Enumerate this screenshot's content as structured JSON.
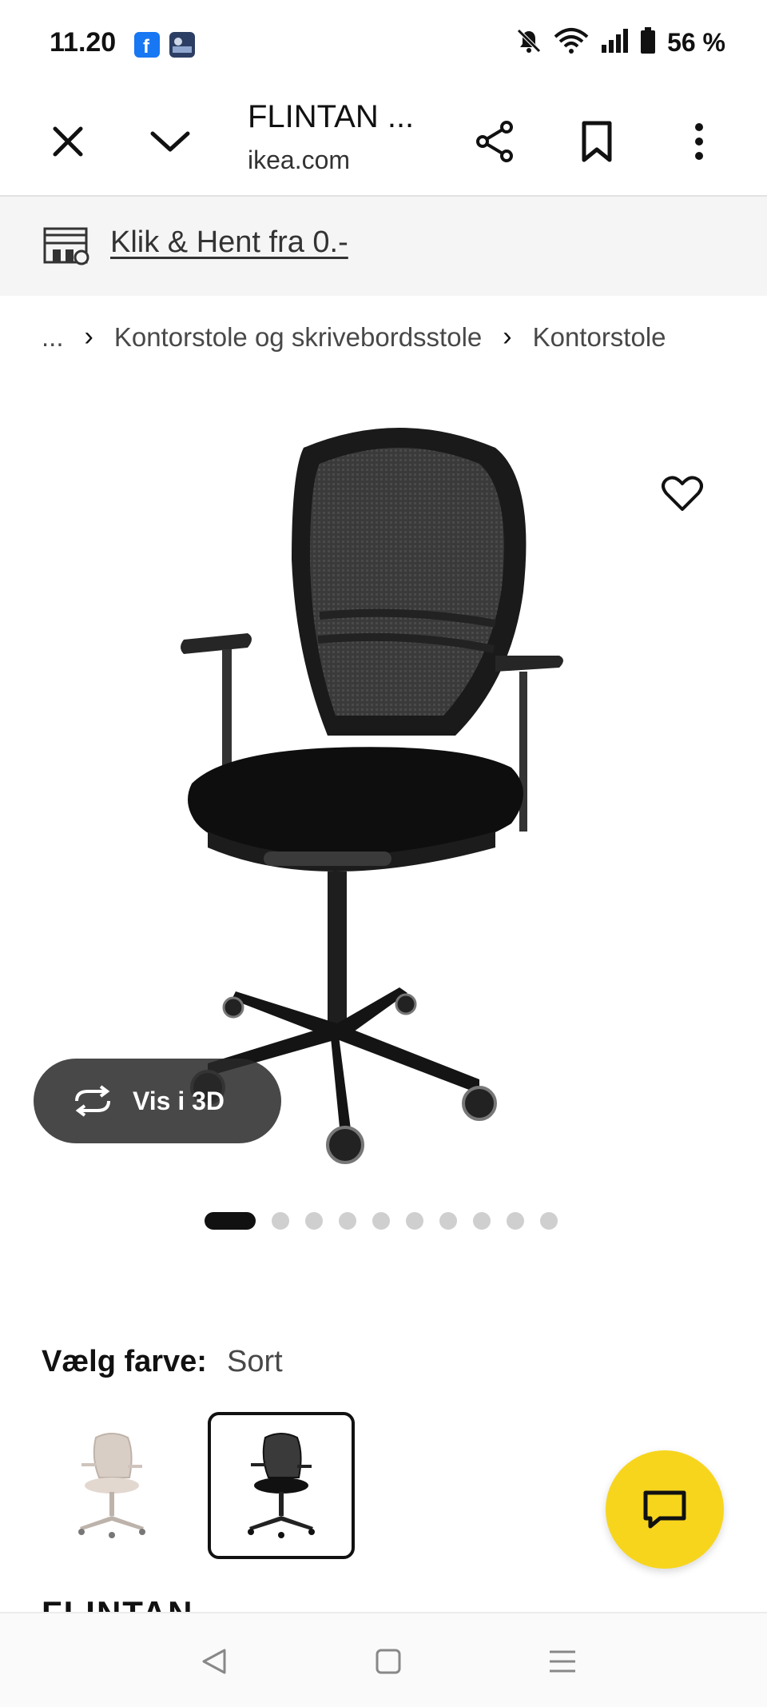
{
  "status_bar": {
    "time": "11.20",
    "battery": "56 %",
    "icons": [
      "facebook-icon",
      "weather-icon",
      "mute-icon",
      "wifi-icon",
      "signal-icon",
      "battery-icon"
    ]
  },
  "browser": {
    "title": "FLINTAN ...",
    "url": "ikea.com",
    "icons": [
      "close-icon",
      "chevron-down-icon",
      "share-icon",
      "bookmark-icon",
      "more-icon"
    ]
  },
  "promo": {
    "text": "Klik & Hent fra 0.-",
    "icon": "store-pickup-icon"
  },
  "breadcrumb": {
    "items": [
      "...",
      "Kontorstole og skrivebordsstole",
      "Kontorstole"
    ]
  },
  "product": {
    "view3d_label": "Vis i 3D",
    "carousel": {
      "total": 10,
      "active": 1
    },
    "color_label": "Vælg farve:",
    "color_value": "Sort",
    "swatches": [
      {
        "name": "beige",
        "selected": false
      },
      {
        "name": "sort",
        "selected": true
      }
    ],
    "name": "FLINTAN"
  },
  "colors": {
    "accent_yellow": "#f7d51d",
    "promo_bg": "#f5f5f5",
    "text_primary": "#111111",
    "text_secondary": "#484848"
  }
}
